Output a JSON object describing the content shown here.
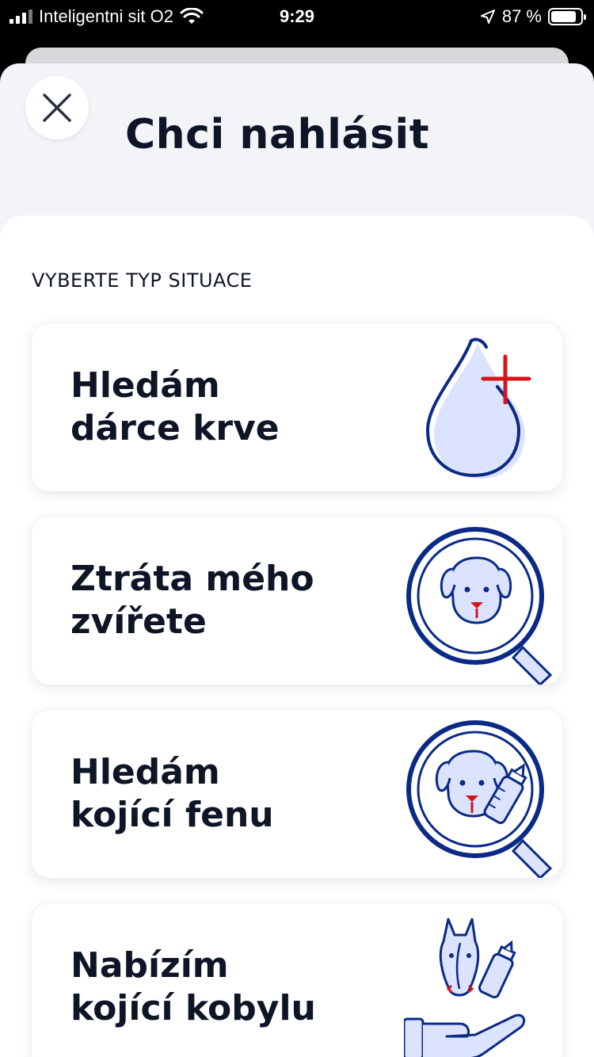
{
  "status_bar": {
    "carrier": "Inteligentni sit O2",
    "time": "9:29",
    "battery": "87 %"
  },
  "header": {
    "title": "Chci nahlásit"
  },
  "section": {
    "label": "VYBERTE TYP SITUACE"
  },
  "cards": [
    {
      "line1": "Hledám",
      "line2": "dárce krve",
      "icon": "blood-drop-icon"
    },
    {
      "line1": "Ztráta mého",
      "line2": "zvířete",
      "icon": "magnifier-dog-icon"
    },
    {
      "line1": "Hledám",
      "line2": "kojící fenu",
      "icon": "magnifier-dog-bottle-icon"
    },
    {
      "line1": "Nabízím",
      "line2": "kojící kobylu",
      "icon": "horse-bottle-hand-icon"
    }
  ],
  "colors": {
    "navy": "#0a2a86",
    "red": "#d8141b",
    "light_blue": "#dbe3ff",
    "text": "#0d1526"
  }
}
